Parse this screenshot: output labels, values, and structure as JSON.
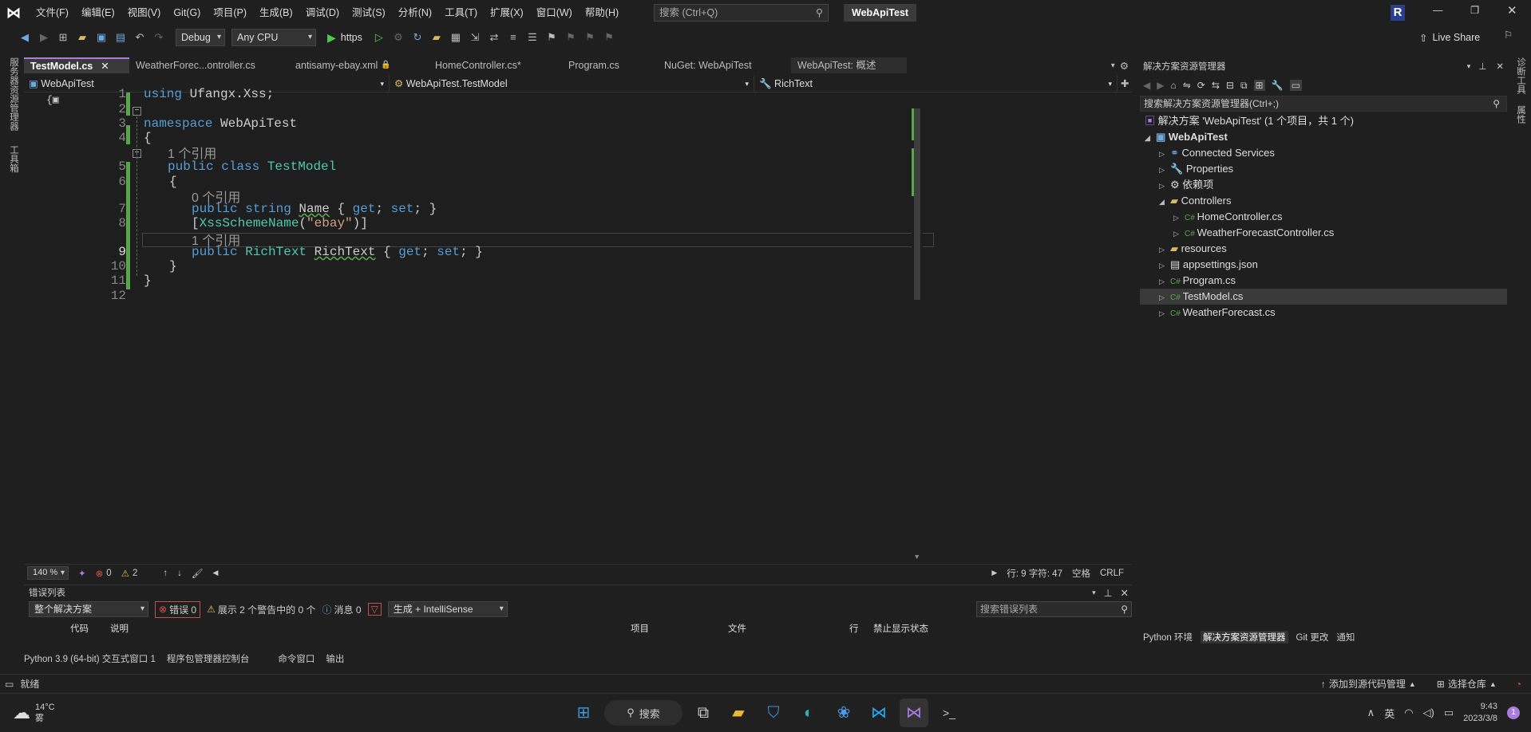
{
  "menu": [
    "文件(F)",
    "编辑(E)",
    "视图(V)",
    "Git(G)",
    "项目(P)",
    "生成(B)",
    "调试(D)",
    "测试(S)",
    "分析(N)",
    "工具(T)",
    "扩展(X)",
    "窗口(W)",
    "帮助(H)"
  ],
  "search": {
    "placeholder": "搜索 (Ctrl+Q)"
  },
  "solution_title": "WebApiTest",
  "account_initial": "R",
  "toolbar": {
    "config": "Debug",
    "platform": "Any CPU",
    "run_target": "https",
    "live_share": "Live Share"
  },
  "left_rail": {
    "server_explorer": "服务器资源管理器",
    "toolbox": "工具箱"
  },
  "right_rail": {
    "diag": "诊断工具",
    "props": "属性"
  },
  "tabs": [
    "TestModel.cs",
    "WeatherForec...ontroller.cs",
    "antisamy-ebay.xml",
    "HomeController.cs*",
    "Program.cs",
    "NuGet: WebApiTest",
    "WebApiTest: 概述"
  ],
  "navbar": {
    "project": "WebApiTest",
    "type": "WebApiTest.TestModel",
    "member": "RichText"
  },
  "code": {
    "l1_kw": "using",
    "l1_ns": " Ufangx.Xss;",
    "l3_kw": "namespace",
    "l3_name": " WebApiTest",
    "brace_open": "{",
    "brace_close": "}",
    "lens1": "1 个引用",
    "l5_kw": "public class ",
    "l5_type": "TestModel",
    "lens0": "0 个引用",
    "l7_kw": "public string ",
    "l7_name": "Name",
    "l7_rest": " { ",
    "l7_get": "get",
    "l7_semi": "; ",
    "l7_set": "set",
    "l7_end": "; }",
    "l8_br": "[",
    "l8_attr": "XssSchemeName",
    "l8_p1": "(",
    "l8_str": "\"ebay\"",
    "l8_p2": ")]",
    "l9_kw": "public ",
    "l9_type": "RichText ",
    "l9_name": "RichText",
    "l9_rest": " { ",
    "l9_get": "get",
    "l9_set": "set",
    "l9_end": "; }"
  },
  "line_numbers": [
    "1",
    "2",
    "3",
    "4",
    "5",
    "6",
    "7",
    "8",
    "9",
    "10",
    "11",
    "12"
  ],
  "status_strip": {
    "zoom": "140 %",
    "errors": "0",
    "warnings": "2",
    "position": "行: 9  字符: 47",
    "spacing": "空格",
    "eol": "CRLF"
  },
  "error_list": {
    "title": "错误列表",
    "scope": "整个解决方案",
    "errors": "错误 0",
    "warnings": "展示 2 个警告中的 0 个",
    "messages": "消息 0",
    "build": "生成 + IntelliSense",
    "search_placeholder": "搜索错误列表",
    "columns": [
      "代码",
      "说明",
      "项目",
      "文件",
      "行",
      "禁止显示状态"
    ]
  },
  "bottom_tabs": [
    "Python 3.9 (64-bit) 交互式窗口 1",
    "程序包管理器控制台",
    "命令窗口",
    "输出"
  ],
  "solution_explorer": {
    "title": "解决方案资源管理器",
    "search_placeholder": "搜索解决方案资源管理器(Ctrl+;)",
    "solution": "解决方案 'WebApiTest' (1 个项目，共 1 个)",
    "project": "WebApiTest",
    "items": [
      "Connected Services",
      "Properties",
      "依赖项",
      "Controllers",
      "HomeController.cs",
      "WeatherForecastController.cs",
      "resources",
      "appsettings.json",
      "Program.cs",
      "TestModel.cs",
      "WeatherForecast.cs"
    ],
    "bottom_tabs": [
      "Python 环境",
      "解决方案资源管理器",
      "Git 更改",
      "通知"
    ]
  },
  "vs_status": {
    "ready": "就绪",
    "source_control": "添加到源代码管理",
    "repo": "选择仓库"
  },
  "taskbar": {
    "temp": "14°C",
    "weather": "雾",
    "search": "搜索",
    "ime": "英",
    "time": "9:43",
    "date": "2023/3/8",
    "notif": "1"
  },
  "colors": {
    "accent": "#a87de0",
    "modified": "#57a64a",
    "keyword": "#569cd6",
    "type": "#4ec9b0",
    "string": "#d69d85"
  }
}
